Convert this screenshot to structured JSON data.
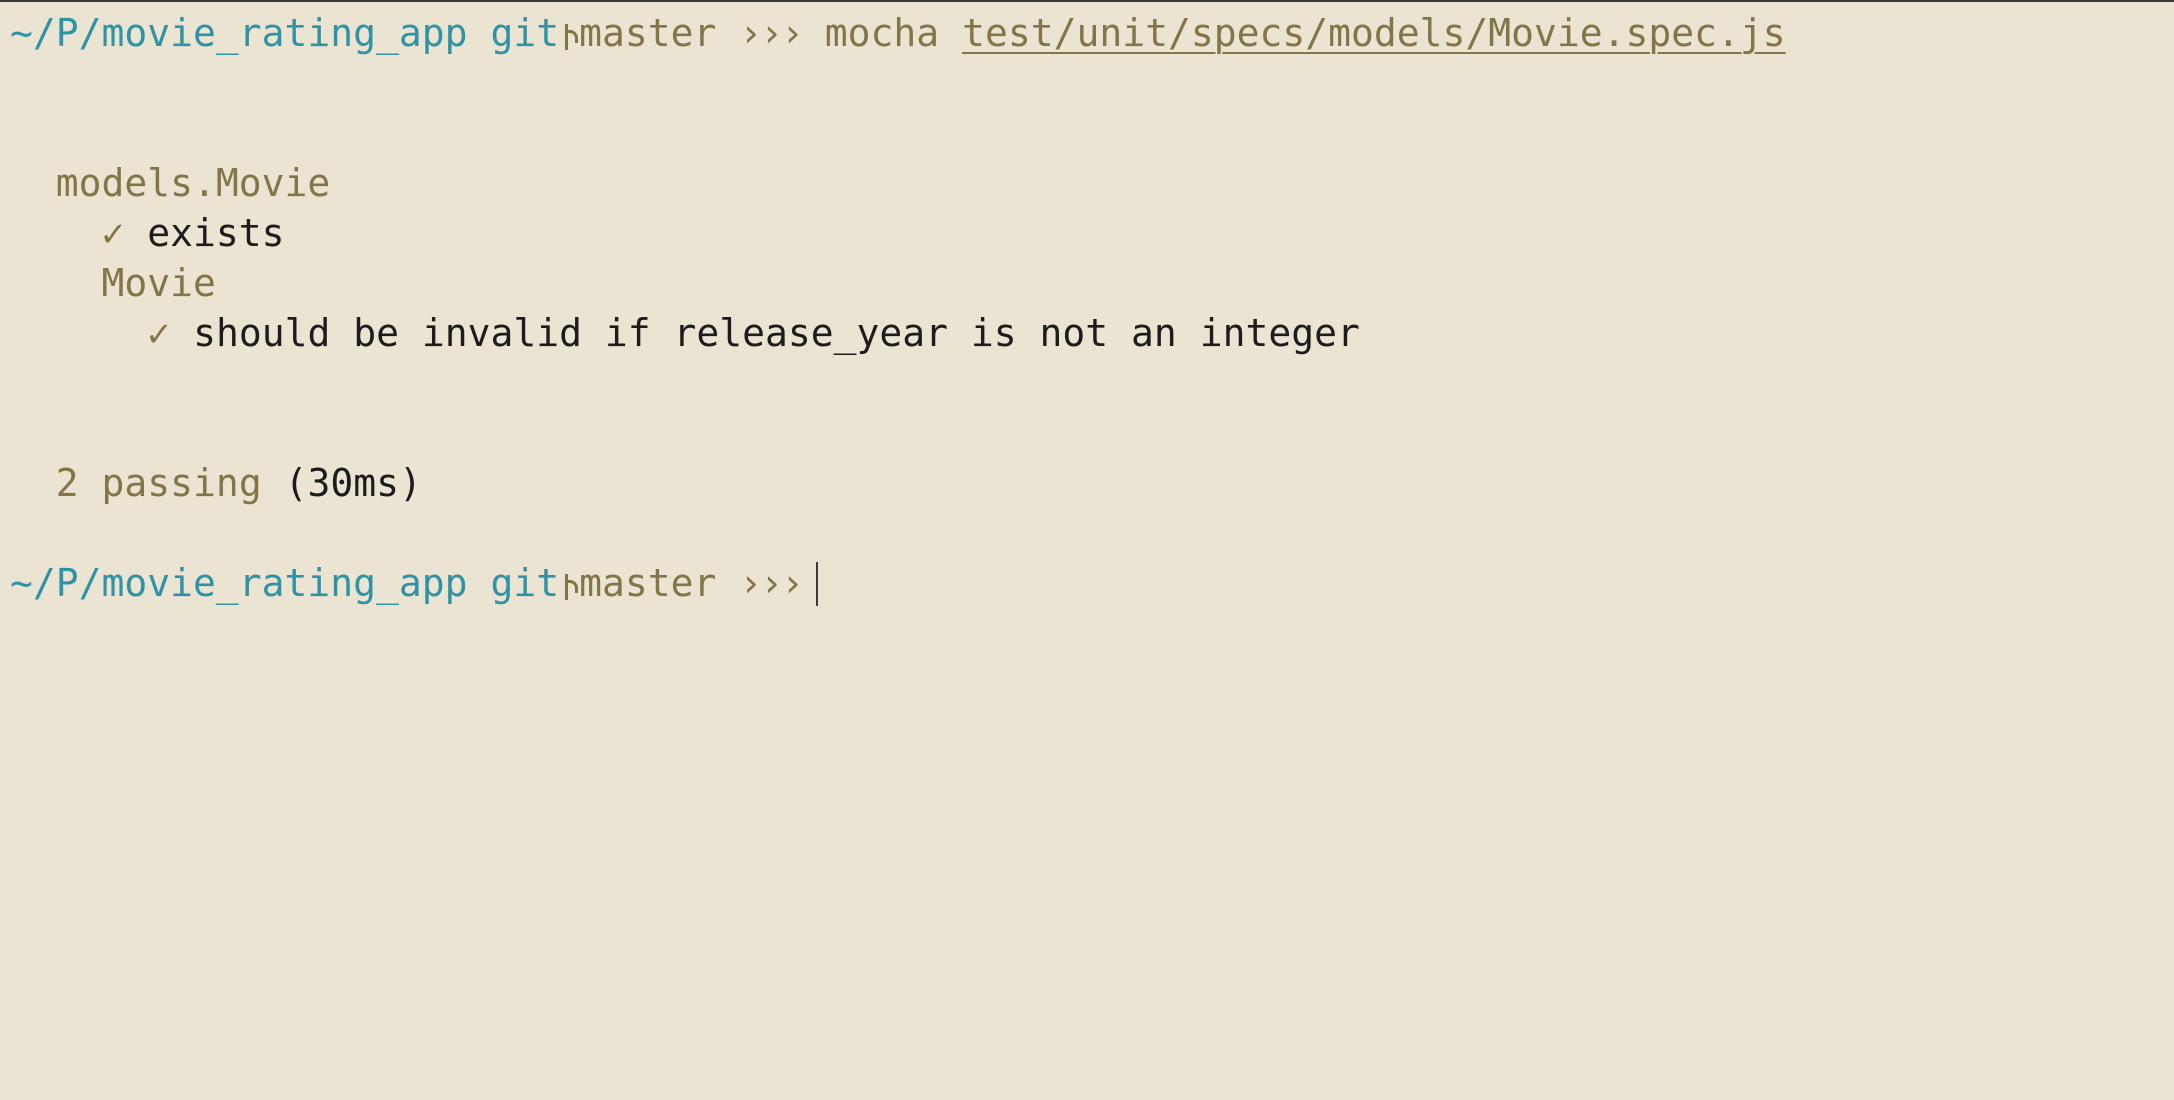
{
  "prompt": {
    "path": "~/P/movie_rating_app",
    "git_label": "git",
    "branch": "master",
    "chevrons": "›››"
  },
  "command": {
    "name": "mocha",
    "argument": "test/unit/specs/models/Movie.spec.js"
  },
  "output": {
    "suite": "models.Movie",
    "suite_tests": [
      {
        "mark": "✓",
        "title": "exists"
      }
    ],
    "nested_suite": "Movie",
    "nested_tests": [
      {
        "mark": "✓",
        "title": "should be invalid if release_year is not an integer"
      }
    ],
    "summary": {
      "count": "2",
      "label": "passing",
      "duration": "(30ms)"
    }
  }
}
